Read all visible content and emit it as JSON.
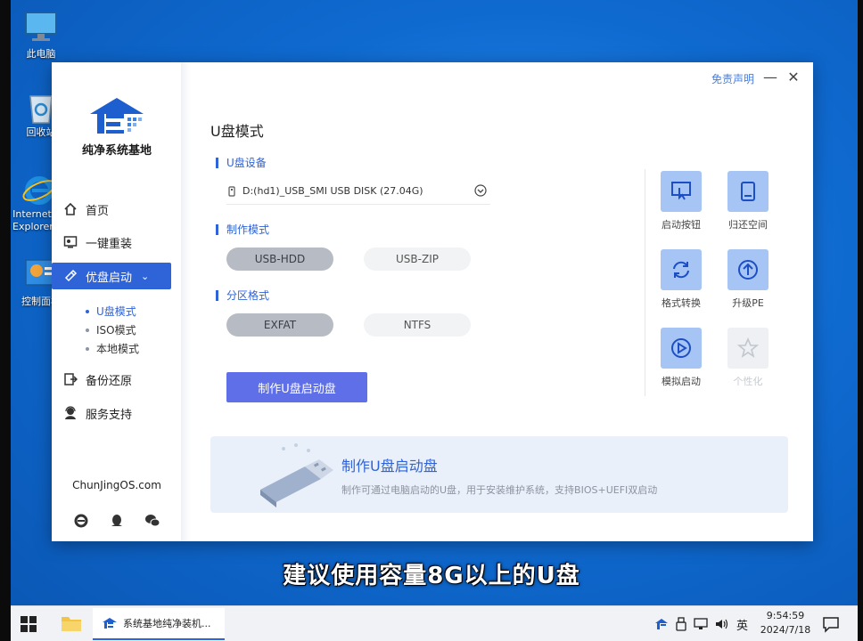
{
  "desktop": {
    "icons": [
      {
        "label": "此电脑",
        "icon": "computer-icon"
      },
      {
        "label": "回收站",
        "icon": "recycle-bin-icon"
      },
      {
        "label": "Internet Explorer",
        "icon": "ie-icon"
      },
      {
        "label": "控制面板",
        "icon": "control-panel-icon"
      }
    ]
  },
  "window": {
    "disclaimer": "免责声明",
    "brand_name": "纯净系统基地",
    "site_url": "ChunJingOS.com",
    "nav": [
      {
        "label": "首页",
        "icon": "home-icon"
      },
      {
        "label": "一键重装",
        "icon": "reinstall-icon"
      },
      {
        "label": "优盘启动",
        "icon": "usb-boot-icon",
        "active": true
      },
      {
        "label": "备份还原",
        "icon": "backup-icon"
      },
      {
        "label": "服务支持",
        "icon": "support-icon"
      }
    ],
    "sub_nav": [
      {
        "label": "U盘模式",
        "active": true
      },
      {
        "label": "ISO模式"
      },
      {
        "label": "本地模式"
      }
    ],
    "social": [
      "ie-icon",
      "qq-icon",
      "wechat-icon"
    ]
  },
  "main": {
    "title": "U盘模式",
    "device_section": "U盘设备",
    "device_value": "D:(hd1)_USB_SMI USB DISK (27.04G)",
    "mode_section": "制作模式",
    "modes": [
      {
        "label": "USB-HDD",
        "selected": true
      },
      {
        "label": "USB-ZIP",
        "selected": false
      }
    ],
    "partition_section": "分区格式",
    "partitions": [
      {
        "label": "EXFAT",
        "selected": true
      },
      {
        "label": "NTFS",
        "selected": false
      }
    ],
    "make_button": "制作U盘启动盘",
    "tools": [
      {
        "label": "启动按钮",
        "icon": "boot-key-icon"
      },
      {
        "label": "归还空间",
        "icon": "restore-space-icon"
      },
      {
        "label": "格式转换",
        "icon": "format-convert-icon"
      },
      {
        "label": "升级PE",
        "icon": "upgrade-icon"
      },
      {
        "label": "模拟启动",
        "icon": "play-icon"
      },
      {
        "label": "个性化",
        "icon": "personalize-icon",
        "disabled": true
      }
    ],
    "banner": {
      "title": "制作U盘启动盘",
      "desc": "制作可通过电脑启动的U盘，用于安装维护系统，支持BIOS+UEFI双启动"
    }
  },
  "caption": "建议使用容量8G以上的U盘",
  "taskbar": {
    "app_title": "系统基地纯净装机...",
    "ime": "英",
    "time": "9:54:59",
    "date": "2024/7/18"
  },
  "colors": {
    "accent": "#2f63d8",
    "button": "#5f6fe7",
    "tool_tile": "#a7c5f4",
    "desktop": "#0f6ad0"
  }
}
